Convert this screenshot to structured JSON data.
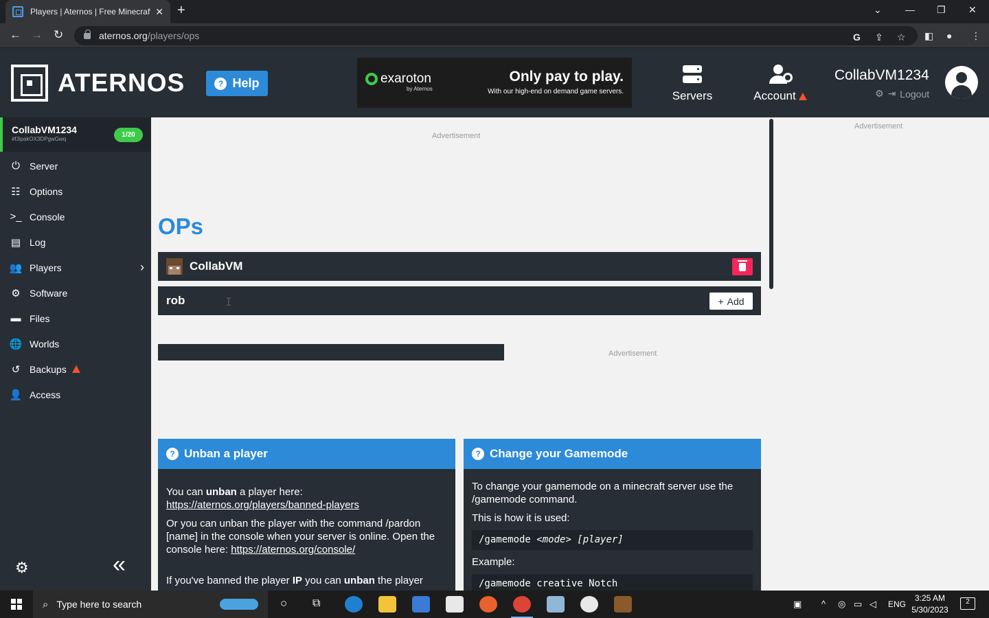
{
  "browser": {
    "tab_title": "Players | Aternos | Free Minecraft Server",
    "url_host": "aternos.org",
    "url_path": "/players/ops"
  },
  "header": {
    "logo_text": "ATERNOS",
    "help_label": "Help",
    "ad": {
      "brand": "exaroton",
      "brand_sub": "by Aternos",
      "headline": "Only pay to play.",
      "copy": "With our high-end on demand game servers."
    },
    "nav_servers": "Servers",
    "nav_account": "Account",
    "username": "CollabVM1234",
    "logout_label": "Logout"
  },
  "sidebar": {
    "server_name": "CollabVM1234",
    "server_id": "#fJipakOX3DPgwGwq",
    "player_count": "1/20",
    "items": [
      {
        "label": "Server",
        "icon": "power-icon"
      },
      {
        "label": "Options",
        "icon": "sliders-icon"
      },
      {
        "label": "Console",
        "icon": "terminal-icon"
      },
      {
        "label": "Log",
        "icon": "file-icon"
      },
      {
        "label": "Players",
        "icon": "users-icon"
      },
      {
        "label": "Software",
        "icon": "gears-icon"
      },
      {
        "label": "Files",
        "icon": "folder-icon"
      },
      {
        "label": "Worlds",
        "icon": "globe-icon"
      },
      {
        "label": "Backups",
        "icon": "history-icon"
      },
      {
        "label": "Access",
        "icon": "user-lock-icon"
      }
    ]
  },
  "main": {
    "ad_label": "Advertisement",
    "title": "OPs",
    "ops": [
      {
        "name": "CollabVM"
      }
    ],
    "add_input_value": "rob",
    "add_label": "Add",
    "cards": {
      "unban": {
        "title": "Unban a player",
        "p1_pre": "You can ",
        "p1_bold": "unban",
        "p1_post": " a player here: ",
        "p1_link": "https://aternos.org/players/banned-players",
        "p2_pre": "Or you can unban the player with the command /pardon [name] in the console when your server is online. Open the console here: ",
        "p2_link": "https://aternos.org/console/",
        "p3_pre": "If you've banned the player ",
        "p3_bold": "IP",
        "p3_mid": " you can ",
        "p3_bold2": "unban",
        "p3_post": " the player"
      },
      "gamemode": {
        "title": "Change your Gamemode",
        "p1": "To change your gamemode on a minecraft server use the /gamemode command.",
        "p2": "This is how it is used:",
        "code1_cmd": "/gamemode ",
        "code1_mode": "<mode>",
        "code1_player": " [player]",
        "p3": "Example:",
        "code2": "/gamemode creative Notch"
      }
    }
  },
  "right_column": {
    "ad_label": "Advertisement"
  },
  "taskbar": {
    "search_placeholder": "Type here to search",
    "language": "ENG",
    "time": "3:25 AM",
    "date": "5/30/2023",
    "notification_count": "2"
  },
  "colors": {
    "header_bg": "#272e35",
    "accent_blue": "#2c8ad8",
    "online_green": "#3fcb4a",
    "delete_red": "#f5265b",
    "warning_orange": "#f4512c"
  }
}
